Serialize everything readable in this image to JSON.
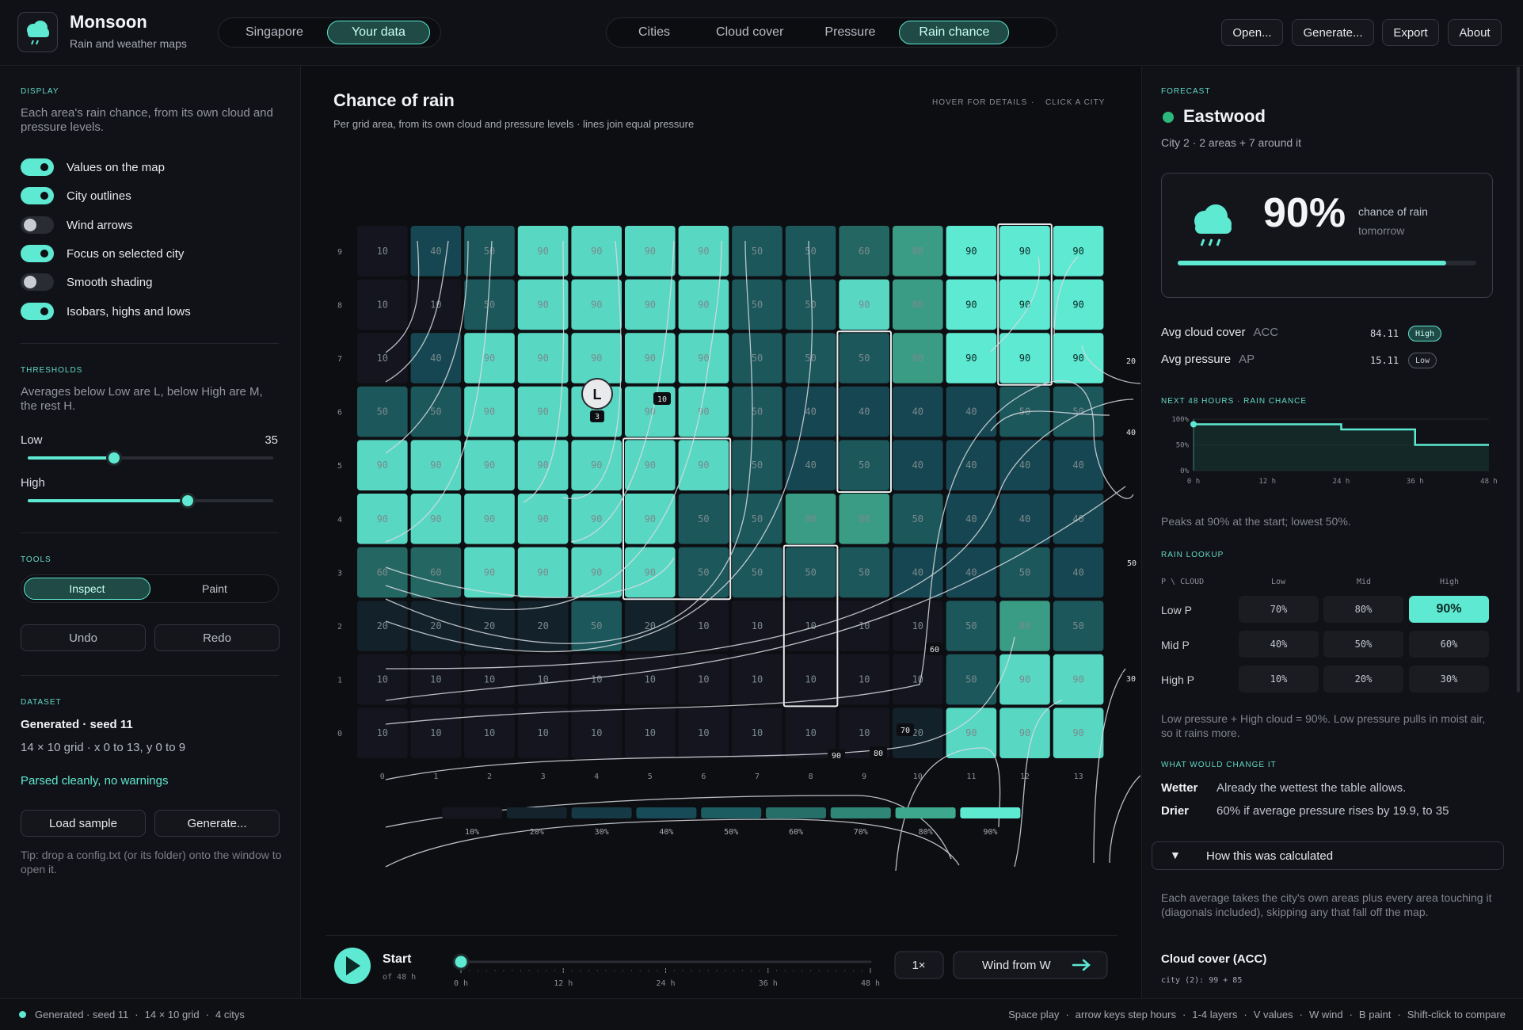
{
  "header": {
    "app_title": "Monsoon",
    "app_subtitle": "Rain and weather maps",
    "source_tabs": [
      "Singapore",
      "Your data"
    ],
    "source_active": 1,
    "layer_tabs": [
      "Cities",
      "Cloud cover",
      "Pressure",
      "Rain chance"
    ],
    "layer_active": 3,
    "buttons": [
      "Open...",
      "Generate...",
      "Export",
      "About"
    ],
    "logo_icon": "rain-cloud-icon"
  },
  "left": {
    "display_heading": "DISPLAY",
    "display_desc": "Each area's rain chance, from its own cloud and pressure levels.",
    "toggles": [
      {
        "label": "Values on the map",
        "on": true
      },
      {
        "label": "City outlines",
        "on": true
      },
      {
        "label": "Wind arrows",
        "on": false
      },
      {
        "label": "Focus on selected city",
        "on": true
      },
      {
        "label": "Smooth shading",
        "on": false
      },
      {
        "label": "Isobars, highs and lows",
        "on": true
      }
    ],
    "thresholds_heading": "THRESHOLDS",
    "thresholds_desc": "Averages below Low are L, below High are M, the rest H.",
    "low_label": "Low",
    "low_value": "35",
    "low_fraction": 0.35,
    "high_label": "High",
    "high_value": "65",
    "high_fraction": 0.65,
    "tools_heading": "TOOLS",
    "tool_modes": [
      "Inspect",
      "Paint"
    ],
    "undo": "Undo",
    "redo": "Redo",
    "dataset_heading": "DATASET",
    "dataset_name": "Generated · seed 11",
    "dataset_meta": "14 × 10 grid  ·  x 0 to 13, y 0 to 9",
    "parse_status": "Parsed cleanly, no warnings",
    "load_sample": "Load sample",
    "generate": "Generate...",
    "tip": "Tip: drop a config.txt (or its folder) onto the window to open it."
  },
  "center": {
    "title": "Chance of rain",
    "subtitle": "Per grid area, from its own cloud and pressure levels  ·  lines join equal pressure",
    "hint_hover": "HOVER FOR DETAILS",
    "hint_sep": "·",
    "hint_click": "CLICK A CITY",
    "legend": [
      "10%",
      "20%",
      "30%",
      "40%",
      "50%",
      "60%",
      "70%",
      "80%",
      "90%"
    ],
    "low_marker": "L",
    "low_marker_value": "3",
    "isobar_labels": [
      "10",
      "20",
      "40",
      "50",
      "30",
      "60",
      "70",
      "80",
      "90"
    ],
    "playback": {
      "play_label": "Start",
      "play_sub": "of 48 h",
      "time_ticks": [
        "0 h",
        "12 h",
        "24 h",
        "36 h",
        "48 h"
      ],
      "progress_fraction": 0,
      "speed": "1×",
      "wind": "Wind from W"
    }
  },
  "chart_data": {
    "type": "heatmap",
    "title": "Chance of rain",
    "x": [
      0,
      1,
      2,
      3,
      4,
      5,
      6,
      7,
      8,
      9,
      10,
      11,
      12,
      13
    ],
    "y": [
      9,
      8,
      7,
      6,
      5,
      4,
      3,
      2,
      1,
      0
    ],
    "values": [
      [
        10,
        40,
        50,
        90,
        90,
        90,
        90,
        50,
        50,
        60,
        80,
        90,
        90,
        90
      ],
      [
        10,
        10,
        50,
        90,
        90,
        90,
        90,
        50,
        50,
        90,
        80,
        90,
        90,
        90
      ],
      [
        10,
        40,
        90,
        90,
        90,
        90,
        90,
        50,
        50,
        50,
        80,
        90,
        90,
        90
      ],
      [
        50,
        50,
        90,
        90,
        90,
        90,
        90,
        50,
        40,
        40,
        40,
        40,
        50,
        50
      ],
      [
        90,
        90,
        90,
        90,
        90,
        90,
        90,
        50,
        40,
        50,
        40,
        40,
        40,
        40
      ],
      [
        90,
        90,
        90,
        90,
        90,
        90,
        50,
        50,
        80,
        80,
        50,
        40,
        40,
        40
      ],
      [
        60,
        60,
        90,
        90,
        90,
        90,
        50,
        50,
        50,
        50,
        40,
        40,
        50,
        40
      ],
      [
        20,
        20,
        20,
        20,
        50,
        20,
        10,
        10,
        10,
        10,
        10,
        50,
        80,
        50
      ],
      [
        10,
        10,
        10,
        10,
        10,
        10,
        10,
        10,
        10,
        10,
        10,
        50,
        90,
        90
      ],
      [
        10,
        10,
        10,
        10,
        10,
        10,
        10,
        10,
        10,
        10,
        20,
        90,
        90,
        90
      ]
    ],
    "selected_city_cells": [
      [
        11,
        9
      ],
      [
        12,
        9
      ],
      [
        13,
        9
      ],
      [
        11,
        8
      ],
      [
        12,
        8
      ],
      [
        13,
        8
      ],
      [
        11,
        7
      ],
      [
        12,
        7
      ],
      [
        13,
        7
      ]
    ],
    "city_outline_cells": [
      [
        9,
        7
      ],
      [
        9,
        6
      ],
      [
        9,
        5
      ],
      [
        5,
        5
      ],
      [
        6,
        5
      ],
      [
        5,
        4
      ],
      [
        6,
        4
      ],
      [
        5,
        3
      ],
      [
        6,
        3
      ],
      [
        8,
        3
      ],
      [
        8,
        2
      ],
      [
        8,
        1
      ]
    ],
    "color_scale": [
      "#161621",
      "#14232c",
      "#153a45",
      "#174b57",
      "#1c5d62",
      "#266f69",
      "#2f8576",
      "#3ea88f",
      "#5ee9d2"
    ]
  },
  "right": {
    "forecast_heading": "FORECAST",
    "city_name": "Eastwood",
    "city_meta": "City 2  ·  2 areas + 7 around it",
    "chance_value": "90%",
    "chance_fraction": 0.9,
    "chance_label": "chance of rain",
    "chance_when": "tomorrow",
    "acc_label": "Avg cloud cover",
    "acc_abbr": "ACC",
    "acc_value": "84.11",
    "acc_badge": "High",
    "ap_label": "Avg pressure",
    "ap_abbr": "AP",
    "ap_value": "15.11",
    "ap_badge": "Low",
    "next_heading": "NEXT 48 HOURS  ·  RAIN CHANCE",
    "mini_chart": {
      "type": "line",
      "x": [
        0,
        12,
        24,
        36,
        48
      ],
      "y_ticks": [
        "100%",
        "50%",
        "0%"
      ],
      "x_ticks": [
        "0 h",
        "12 h",
        "24 h",
        "36 h",
        "48 h"
      ],
      "steps": [
        [
          0,
          90
        ],
        [
          24,
          90
        ],
        [
          24,
          80
        ],
        [
          36,
          80
        ],
        [
          36,
          50
        ],
        [
          48,
          50
        ]
      ]
    },
    "peak_text": "Peaks at 90% at the start; lowest 50%.",
    "lookup_heading": "RAIN LOOKUP",
    "lookup_corner": "P \\ CLOUD",
    "lookup_cols": [
      "Low",
      "Mid",
      "High"
    ],
    "lookup_rows": [
      {
        "label": "Low P",
        "values": [
          "70%",
          "80%",
          "90%"
        ]
      },
      {
        "label": "Mid P",
        "values": [
          "40%",
          "50%",
          "60%"
        ]
      },
      {
        "label": "High P",
        "values": [
          "10%",
          "20%",
          "30%"
        ]
      }
    ],
    "lookup_note": "Low pressure + High cloud = 90%. Low pressure pulls in moist air, so it rains more.",
    "change_heading": "WHAT WOULD CHANGE IT",
    "wetter_label": "Wetter",
    "wetter_text": "Already the wettest the table allows.",
    "drier_label": "Drier",
    "drier_text": "60% if average pressure rises by 19.9, to 35",
    "calc_toggle": "How this was calculated",
    "calc_text": "Each average takes the city's own areas plus every area touching it (diagonals included), skipping any that fall off the map.",
    "acc_section": "Cloud cover (ACC)",
    "acc_detail": "city (2): 99 + 85"
  },
  "status": {
    "left_items": [
      "Generated · seed 11",
      "14 × 10 grid",
      "4 citys"
    ],
    "shortcuts": [
      "Space play",
      "arrow keys step hours",
      "1-4 layers",
      "V values",
      "W wind",
      "B paint",
      "Shift-click to compare"
    ]
  }
}
